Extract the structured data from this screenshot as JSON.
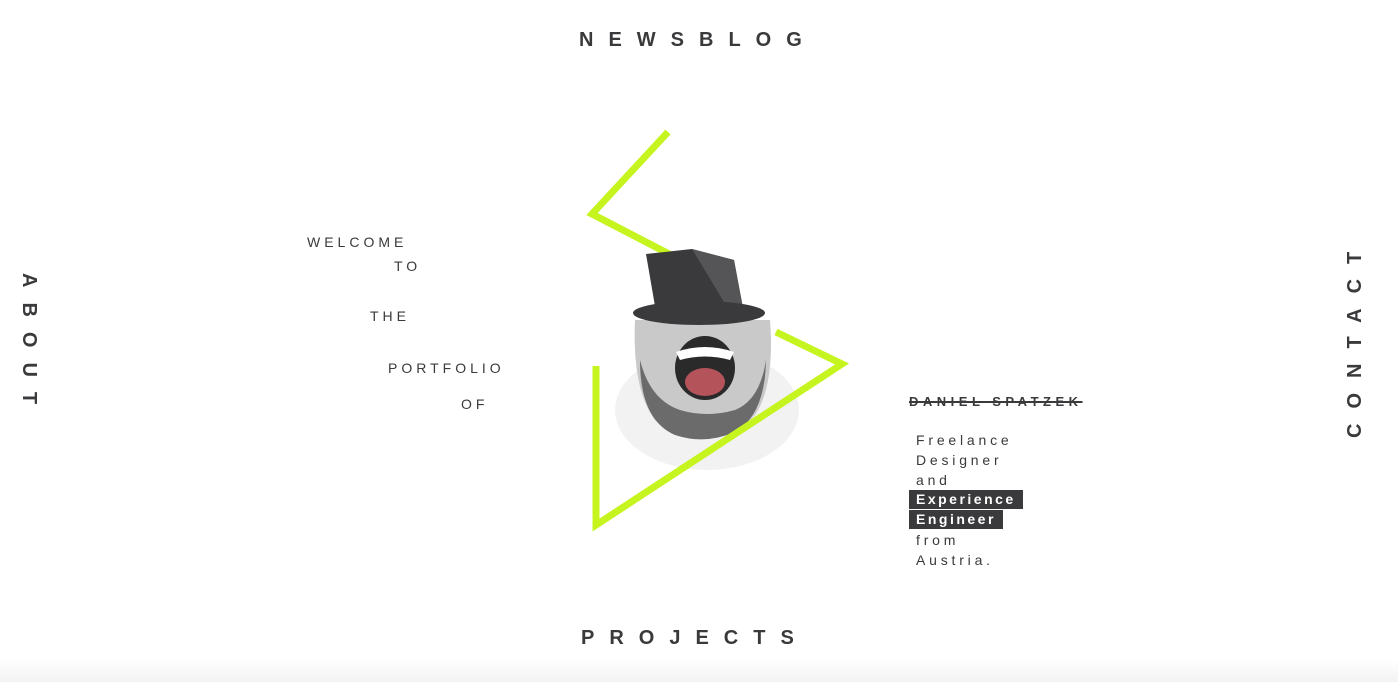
{
  "nav": {
    "top": "NEWSBLOG",
    "bottom": "PROJECTS",
    "left": "ABOUT",
    "right": "CONTACT"
  },
  "welcome": [
    "WELCOME",
    "TO",
    "THE",
    "PORTFOLIO",
    "OF"
  ],
  "person": {
    "name": "DANIEL SPATZEK",
    "lines": [
      "Freelance",
      "Designer",
      "and"
    ],
    "highlight": [
      "Experience",
      "Engineer"
    ],
    "tail": [
      "from",
      "Austria."
    ]
  },
  "colors": {
    "accent": "#c6f41e",
    "text": "#3a3a3c",
    "background": "#ffffff"
  }
}
